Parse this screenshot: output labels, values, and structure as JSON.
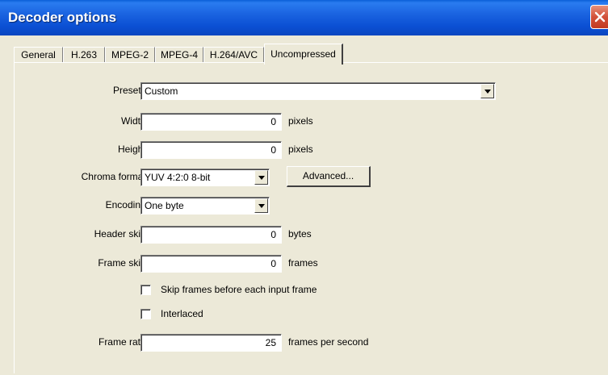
{
  "window": {
    "title": "Decoder options",
    "close_icon": "close-icon"
  },
  "tabs": [
    {
      "label": "General"
    },
    {
      "label": "H.263"
    },
    {
      "label": "MPEG-2"
    },
    {
      "label": "MPEG-4"
    },
    {
      "label": "H.264/AVC"
    },
    {
      "label": "Uncompressed",
      "active": true
    }
  ],
  "form": {
    "presets": {
      "label": "Presets:",
      "value": "Custom"
    },
    "width": {
      "label": "Width:",
      "value": "0",
      "unit": "pixels"
    },
    "height": {
      "label": "Height:",
      "value": "0",
      "unit": "pixels"
    },
    "chroma": {
      "label": "Chroma format:",
      "value": "YUV 4:2:0 8-bit"
    },
    "advanced_button": "Advanced...",
    "encoding": {
      "label": "Encoding:",
      "value": "One byte"
    },
    "header_skip": {
      "label": "Header skip:",
      "value": "0",
      "unit": "bytes"
    },
    "frame_skip": {
      "label": "Frame skip:",
      "value": "0",
      "unit": "frames"
    },
    "skip_frames_checkbox": {
      "label": "Skip frames before each input frame",
      "checked": false
    },
    "interlaced_checkbox": {
      "label": "Interlaced",
      "checked": false
    },
    "frame_rate": {
      "label": "Frame rate:",
      "value": "25",
      "unit": "frames per second"
    }
  }
}
